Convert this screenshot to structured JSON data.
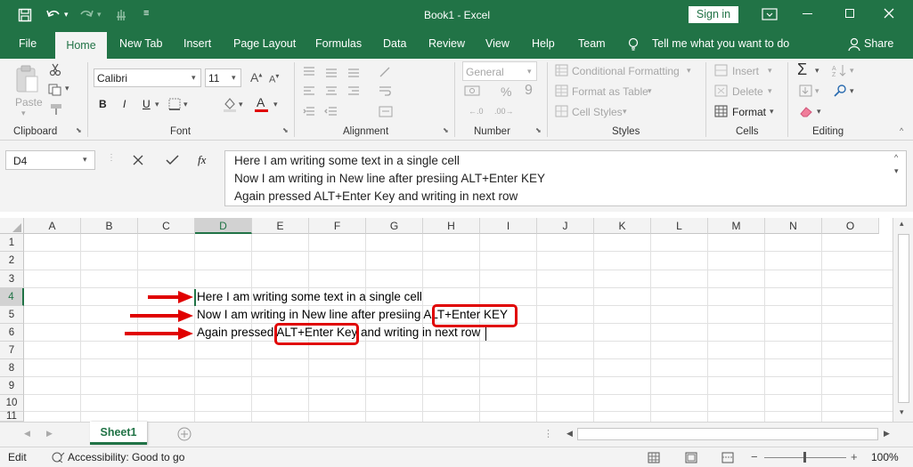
{
  "title_bar": {
    "doc_title": "Book1  -  Excel",
    "sign_in_label": "Sign in",
    "icons": [
      "save-icon",
      "undo-icon",
      "redo-icon",
      "touch-mode-icon",
      "customize-icon",
      "ribbon-display-icon",
      "minimize-icon",
      "maximize-icon",
      "close-icon"
    ]
  },
  "ribbon_tabs": {
    "file": "File",
    "home": "Home",
    "new_tab": "New Tab",
    "insert": "Insert",
    "page_layout": "Page Layout",
    "formulas": "Formulas",
    "data": "Data",
    "review": "Review",
    "view": "View",
    "help": "Help",
    "team": "Team",
    "tell_me": "Tell me what you want to do",
    "share": "Share"
  },
  "ribbon": {
    "clipboard": {
      "paste": "Paste",
      "label": "Clipboard"
    },
    "font": {
      "name": "Calibri",
      "size": "11",
      "bold": "B",
      "italic": "I",
      "underline": "U",
      "label": "Font"
    },
    "alignment": {
      "label": "Alignment"
    },
    "number": {
      "format": "General",
      "percent": "%",
      "comma": "9",
      "label": "Number"
    },
    "styles": {
      "conditional": "Conditional Formatting",
      "format_table": "Format as Table",
      "cell_styles": "Cell Styles",
      "label": "Styles"
    },
    "cells": {
      "insert": "Insert",
      "delete": "Delete",
      "format": "Format",
      "label": "Cells"
    },
    "editing": {
      "label": "Editing"
    }
  },
  "formula_bar": {
    "name_box": "D4",
    "fx": "fx",
    "lines": [
      "Here I am writing some text in a single cell",
      "Now I am writing in New line after presiing ALT+Enter KEY",
      "Again pressed ALT+Enter Key and writing in next row"
    ]
  },
  "grid": {
    "columns": [
      "A",
      "B",
      "C",
      "D",
      "E",
      "F",
      "G",
      "H",
      "I",
      "J",
      "K",
      "L",
      "M",
      "N",
      "O"
    ],
    "rows": [
      "1",
      "2",
      "3",
      "4",
      "5",
      "6",
      "7",
      "8",
      "9",
      "10",
      "11"
    ],
    "active_cell": "D4",
    "cell_d4_lines": {
      "line1": "Here I am writing some text in a single cell",
      "line2_pre": "Now I am writing in New line after presiing ",
      "line2_key": "ALT+Enter KEY",
      "line3_pre": "Again pressed ",
      "line3_key": "ALT+Enter Key",
      "line3_post": " and writing in next row"
    },
    "annotation_color": "#e00000"
  },
  "sheets": {
    "tabs": [
      "Sheet1"
    ],
    "active": "Sheet1"
  },
  "status_bar": {
    "mode": "Edit",
    "accessibility": "Accessibility: Good to go",
    "zoom": "100%"
  },
  "colors": {
    "accent": "#217346",
    "ribbon_bg": "#f3f3f3",
    "annotation": "#e00000"
  }
}
